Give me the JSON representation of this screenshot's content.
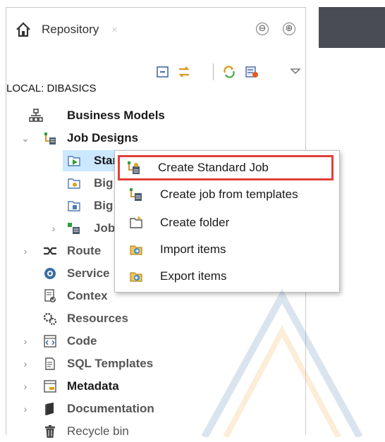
{
  "repository": {
    "tab_label": "Repository",
    "tab_close": "×",
    "minimize": "⊖",
    "maximize": "⊕",
    "local_label": "LOCAL: DIBASICS"
  },
  "tree": {
    "items": [
      {
        "label": "Business Models"
      },
      {
        "label": "Job Designs"
      },
      {
        "label": "Standard"
      },
      {
        "label": "Big"
      },
      {
        "label": "Big"
      },
      {
        "label": "Job"
      },
      {
        "label": "Route"
      },
      {
        "label": "Service"
      },
      {
        "label": "Contex"
      },
      {
        "label": "Resources"
      },
      {
        "label": "Code"
      },
      {
        "label": "SQL Templates"
      },
      {
        "label": "Metadata"
      },
      {
        "label": "Documentation"
      },
      {
        "label": "Recycle bin"
      }
    ]
  },
  "context_menu": {
    "items": [
      {
        "label": "Create Standard Job"
      },
      {
        "label": "Create job from templates"
      },
      {
        "label": "Create folder"
      },
      {
        "label": "Import items"
      },
      {
        "label": "Export items"
      }
    ]
  },
  "colors": {
    "selection": "#cce8ff",
    "highlight_border": "#e0403a",
    "dark_strip": "#4a4c55"
  }
}
